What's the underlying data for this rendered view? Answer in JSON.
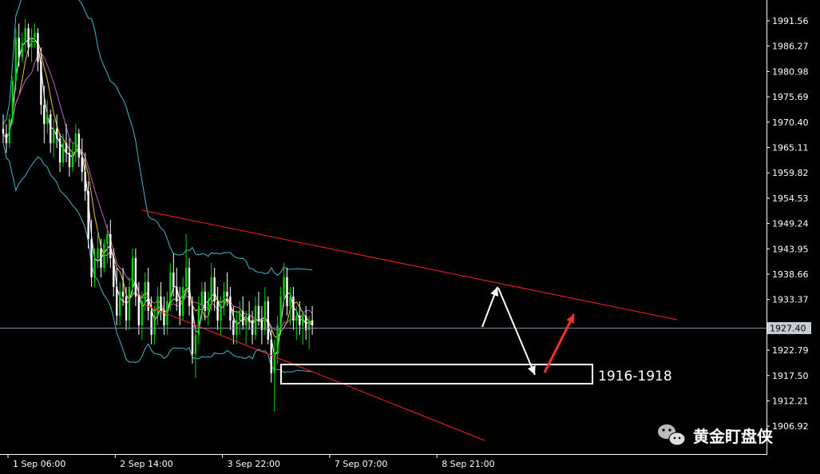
{
  "chart_data": {
    "type": "candlestick",
    "y_axis_ticks": [
      "1991.56",
      "1986.27",
      "1980.98",
      "1975.69",
      "1970.40",
      "1965.11",
      "1959.82",
      "1954.53",
      "1949.24",
      "1943.95",
      "1938.66",
      "1933.37",
      "1922.79",
      "1917.50",
      "1912.21",
      "1906.92"
    ],
    "ylim": [
      1904.0,
      1995.0
    ],
    "current_price": "1927.40",
    "x_axis_ticks": [
      "1 Sep 06:00",
      "2 Sep 14:00",
      "3 Sep 22:00",
      "7 Sep 07:00",
      "8 Sep 21:00"
    ],
    "x_tick_index": [
      0,
      34,
      68,
      102,
      136
    ],
    "candles": [
      [
        1969,
        1972,
        1966,
        1968
      ],
      [
        1968,
        1970,
        1964,
        1966
      ],
      [
        1966,
        1972,
        1965,
        1971
      ],
      [
        1971,
        1980,
        1970,
        1979
      ],
      [
        1979,
        1990,
        1977,
        1988
      ],
      [
        1988,
        1991,
        1982,
        1984
      ],
      [
        1984,
        1989,
        1983,
        1987
      ],
      [
        1987,
        1992,
        1985,
        1990
      ],
      [
        1990,
        1991,
        1984,
        1986
      ],
      [
        1986,
        1990,
        1983,
        1988
      ],
      [
        1988,
        1991,
        1986,
        1989
      ],
      [
        1989,
        1990,
        1981,
        1983
      ],
      [
        1983,
        1986,
        1972,
        1974
      ],
      [
        1974,
        1978,
        1966,
        1970
      ],
      [
        1970,
        1975,
        1968,
        1972
      ],
      [
        1972,
        1973,
        1964,
        1966
      ],
      [
        1966,
        1971,
        1963,
        1969
      ],
      [
        1969,
        1972,
        1965,
        1967
      ],
      [
        1967,
        1968,
        1960,
        1962
      ],
      [
        1962,
        1968,
        1961,
        1966
      ],
      [
        1966,
        1970,
        1962,
        1964
      ],
      [
        1964,
        1967,
        1959,
        1961
      ],
      [
        1961,
        1966,
        1960,
        1964
      ],
      [
        1964,
        1970,
        1962,
        1968
      ],
      [
        1968,
        1969,
        1961,
        1963
      ],
      [
        1963,
        1967,
        1958,
        1960
      ],
      [
        1960,
        1964,
        1954,
        1956
      ],
      [
        1956,
        1958,
        1944,
        1946
      ],
      [
        1946,
        1950,
        1936,
        1938
      ],
      [
        1938,
        1944,
        1936,
        1942
      ],
      [
        1942,
        1948,
        1940,
        1944
      ],
      [
        1944,
        1946,
        1938,
        1940
      ],
      [
        1940,
        1946,
        1939,
        1945
      ],
      [
        1945,
        1949,
        1941,
        1947
      ],
      [
        1947,
        1950,
        1940,
        1942
      ],
      [
        1942,
        1944,
        1934,
        1936
      ],
      [
        1936,
        1940,
        1928,
        1930
      ],
      [
        1930,
        1937,
        1928,
        1935
      ],
      [
        1935,
        1940,
        1932,
        1934
      ],
      [
        1934,
        1936,
        1927,
        1929
      ],
      [
        1929,
        1938,
        1927,
        1936
      ],
      [
        1936,
        1944,
        1934,
        1942
      ],
      [
        1942,
        1944,
        1932,
        1934
      ],
      [
        1934,
        1937,
        1926,
        1928
      ],
      [
        1928,
        1935,
        1925,
        1933
      ],
      [
        1933,
        1939,
        1931,
        1937
      ],
      [
        1937,
        1940,
        1929,
        1931
      ],
      [
        1931,
        1934,
        1924,
        1926
      ],
      [
        1926,
        1932,
        1924,
        1930
      ],
      [
        1930,
        1936,
        1928,
        1934
      ],
      [
        1934,
        1937,
        1929,
        1931
      ],
      [
        1931,
        1934,
        1926,
        1928
      ],
      [
        1928,
        1935,
        1926,
        1933
      ],
      [
        1933,
        1941,
        1931,
        1939
      ],
      [
        1939,
        1943,
        1934,
        1936
      ],
      [
        1936,
        1940,
        1931,
        1933
      ],
      [
        1933,
        1936,
        1928,
        1930
      ],
      [
        1930,
        1938,
        1929,
        1936
      ],
      [
        1936,
        1947,
        1934,
        1940
      ],
      [
        1940,
        1942,
        1930,
        1932
      ],
      [
        1932,
        1934,
        1920,
        1922
      ],
      [
        1922,
        1928,
        1917,
        1926
      ],
      [
        1926,
        1934,
        1924,
        1932
      ],
      [
        1932,
        1937,
        1929,
        1935
      ],
      [
        1935,
        1937,
        1929,
        1931
      ],
      [
        1931,
        1935,
        1928,
        1933
      ],
      [
        1933,
        1941,
        1931,
        1938
      ],
      [
        1938,
        1940,
        1931,
        1933
      ],
      [
        1933,
        1936,
        1927,
        1929
      ],
      [
        1929,
        1934,
        1926,
        1932
      ],
      [
        1932,
        1937,
        1930,
        1935
      ],
      [
        1935,
        1939,
        1932,
        1934
      ],
      [
        1934,
        1936,
        1927,
        1929
      ],
      [
        1929,
        1932,
        1924,
        1926
      ],
      [
        1926,
        1931,
        1924,
        1929
      ],
      [
        1929,
        1933,
        1926,
        1931
      ],
      [
        1931,
        1934,
        1927,
        1928
      ],
      [
        1928,
        1931,
        1924,
        1930
      ],
      [
        1930,
        1933,
        1927,
        1929
      ],
      [
        1929,
        1931,
        1924,
        1926
      ],
      [
        1926,
        1934,
        1925,
        1932
      ],
      [
        1932,
        1935,
        1928,
        1929
      ],
      [
        1929,
        1932,
        1924,
        1927
      ],
      [
        1927,
        1936,
        1926,
        1933
      ],
      [
        1933,
        1934,
        1924,
        1925
      ],
      [
        1925,
        1927,
        1916,
        1918
      ],
      [
        1918,
        1925,
        1910,
        1922
      ],
      [
        1922,
        1930,
        1920,
        1928
      ],
      [
        1928,
        1936,
        1926,
        1934
      ],
      [
        1934,
        1941,
        1932,
        1938
      ],
      [
        1938,
        1940,
        1930,
        1932
      ],
      [
        1932,
        1936,
        1928,
        1934
      ],
      [
        1934,
        1936,
        1927,
        1929
      ],
      [
        1929,
        1932,
        1925,
        1930
      ],
      [
        1930,
        1933,
        1926,
        1928
      ],
      [
        1928,
        1931,
        1924,
        1930
      ],
      [
        1930,
        1932,
        1925,
        1927
      ],
      [
        1927,
        1930,
        1923,
        1929
      ],
      [
        1929,
        1932,
        1926,
        1928
      ]
    ]
  },
  "annotations": {
    "support_zone_label": "1916-1918"
  },
  "watermark": {
    "text": "黄金盯盘侠",
    "icon": "wechat-icon"
  },
  "colors": {
    "bull": "#00d000",
    "bear": "#ffffff",
    "channel": "#ff2020",
    "bollinger": "#3fb8c8",
    "ma_fast": "#ffffff",
    "ma_mid": "#f0c040",
    "ma_slow": "#c060c0",
    "current_line": "#7a8aa0",
    "arrow_white": "#ffffff",
    "arrow_red": "#ff3030"
  }
}
